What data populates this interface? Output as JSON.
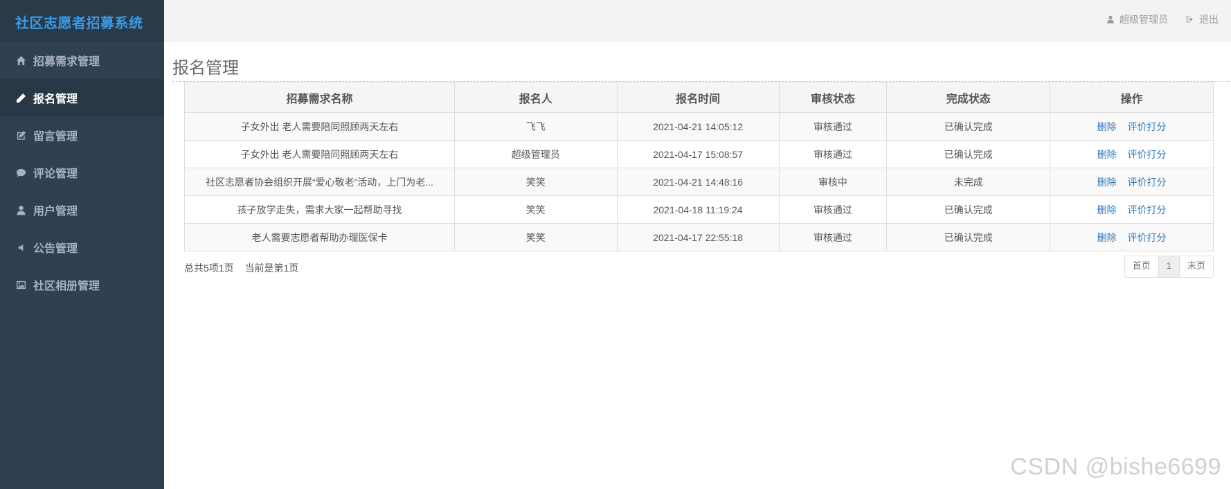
{
  "app": {
    "title": "社区志愿者招募系统"
  },
  "sidebar": {
    "items": [
      {
        "label": "招募需求管理",
        "icon": "home-icon"
      },
      {
        "label": "报名管理",
        "icon": "pencil-icon",
        "active": true
      },
      {
        "label": "留言管理",
        "icon": "edit-icon"
      },
      {
        "label": "评论管理",
        "icon": "comment-icon"
      },
      {
        "label": "用户管理",
        "icon": "user-icon"
      },
      {
        "label": "公告管理",
        "icon": "volume-icon"
      },
      {
        "label": "社区相册管理",
        "icon": "image-icon"
      }
    ]
  },
  "topbar": {
    "user_label": "超级管理员",
    "logout_label": "退出"
  },
  "page": {
    "title": "报名管理"
  },
  "table": {
    "headers": [
      "招募需求名称",
      "报名人",
      "报名时间",
      "审核状态",
      "完成状态",
      "操作"
    ],
    "rows": [
      {
        "name": "子女外出 老人需要陪同照顾两天左右",
        "user": "飞飞",
        "time": "2021-04-21 14:05:12",
        "audit": "审核通过",
        "done": "已确认完成"
      },
      {
        "name": "子女外出 老人需要陪同照顾两天左右",
        "user": "超级管理员",
        "time": "2021-04-17 15:08:57",
        "audit": "审核通过",
        "done": "已确认完成"
      },
      {
        "name": "社区志愿者协会组织开展“爱心敬老”活动，上门为老...",
        "user": "笑笑",
        "time": "2021-04-21 14:48:16",
        "audit": "审核中",
        "done": "未完成"
      },
      {
        "name": "孩子放学走失，需求大家一起帮助寻找",
        "user": "笑笑",
        "time": "2021-04-18 11:19:24",
        "audit": "审核通过",
        "done": "已确认完成"
      },
      {
        "name": "老人需要志愿者帮助办理医保卡",
        "user": "笑笑",
        "time": "2021-04-17 22:55:18",
        "audit": "审核通过",
        "done": "已确认完成"
      }
    ],
    "actions": {
      "delete": "删除",
      "rate": "评价打分"
    }
  },
  "footer": {
    "total": "总共5项1页",
    "current": "当前是第1页"
  },
  "pager": {
    "first": "首页",
    "page": "1",
    "last": "末页"
  },
  "watermark": "CSDN @bishe6699",
  "colors": {
    "sidebar_bg": "#2f4050",
    "brand_text": "#3b9be6",
    "link": "#337ab7"
  }
}
